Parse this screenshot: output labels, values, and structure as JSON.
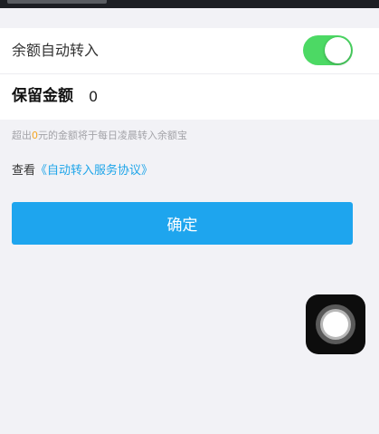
{
  "auto_transfer": {
    "label": "余额自动转入",
    "enabled": true
  },
  "retain_amount": {
    "label": "保留金额",
    "value": "0"
  },
  "hint": {
    "prefix": "超出",
    "amount": "0",
    "suffix": "元的金额将于每日凌晨转入余额宝"
  },
  "agreement": {
    "prefix": "查看",
    "link": "《自动转入服务协议》"
  },
  "confirm_label": "确定",
  "colors": {
    "toggle_on": "#4cd964",
    "primary": "#1ea5ee",
    "link": "#1ea5e9",
    "highlight": "#f5a623"
  },
  "icons": {
    "floating_button": "assistive-touch-icon"
  }
}
